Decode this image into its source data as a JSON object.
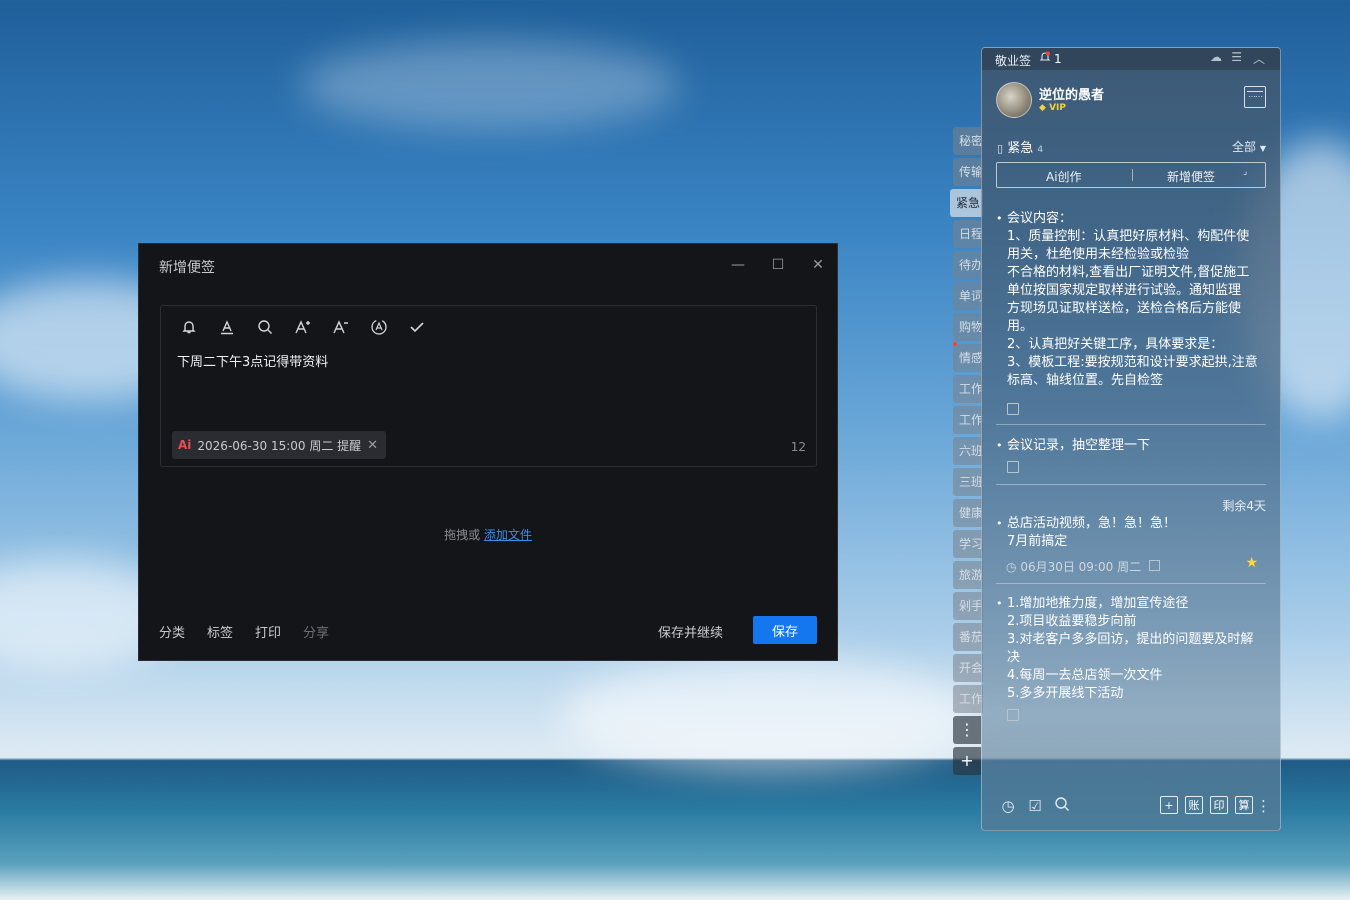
{
  "editor": {
    "title": "新增便签",
    "toolbar": [
      "bell-icon",
      "font-color-icon",
      "search-icon",
      "font-increase-icon",
      "font-decrease-icon",
      "auto-format-icon",
      "check-icon"
    ],
    "content": "下周二下午3点记得带资料",
    "reminder_chip": {
      "ai_label": "Ai",
      "text": "2026-06-30 15:00 周二 提醒"
    },
    "char_count": "12",
    "drop_text": "拖拽或",
    "drop_link": "添加文件",
    "footer_links": [
      "分类",
      "标签",
      "打印",
      "分享"
    ],
    "save_continue": "保存并继续",
    "save": "保存"
  },
  "side_tabs": [
    "秘密",
    "传输",
    "紧急",
    "日程",
    "待办",
    "单词",
    "购物",
    "情感",
    "工作",
    "工作",
    "六班",
    "三班",
    "健康",
    "学习",
    "旅游",
    "剁手",
    "番茄",
    "开会",
    "工作"
  ],
  "side_tabs_active": "紧急",
  "panel": {
    "app_name": "敬业签",
    "notification_count": "1",
    "username": "逆位的愚者",
    "vip_label": "VIP",
    "category": "紧急",
    "category_count": "4",
    "filter": "全部",
    "seg_left": "Ai创作",
    "seg_right": "新增便签",
    "notes": [
      {
        "lines": [
          "会议内容：",
          "1、质量控制：认真把好原材料、构配件使",
          "用关，杜绝使用未经检验或检验",
          "不合格的材料,查看出厂证明文件,督促施工",
          "单位按国家规定取样进行试验。通知监理",
          "方现场见证取样送检，送检合格后方能使",
          "用。",
          "2、认真把好关键工序，具体要求是：",
          "3、模板工程:要按规范和设计要求起拱,注意",
          "标高、轴线位置。先自检签"
        ]
      },
      {
        "lines": [
          "会议记录，抽空整理一下"
        ]
      },
      {
        "remaining": "剩余4天",
        "lines": [
          "总店活动视频，急！急！急！",
          "7月前搞定"
        ],
        "meta": "06月30日 09:00 周二"
      },
      {
        "lines": [
          "1.增加地推力度，增加宣传途径",
          "2.项目收益要稳步向前",
          "3.对老客户多多回访，提出的问题要及时解",
          "决",
          "4.每周一去总店领一次文件",
          "5.多多开展线下活动"
        ]
      }
    ],
    "footer_boxes": [
      "+",
      "账",
      "印",
      "算"
    ]
  }
}
